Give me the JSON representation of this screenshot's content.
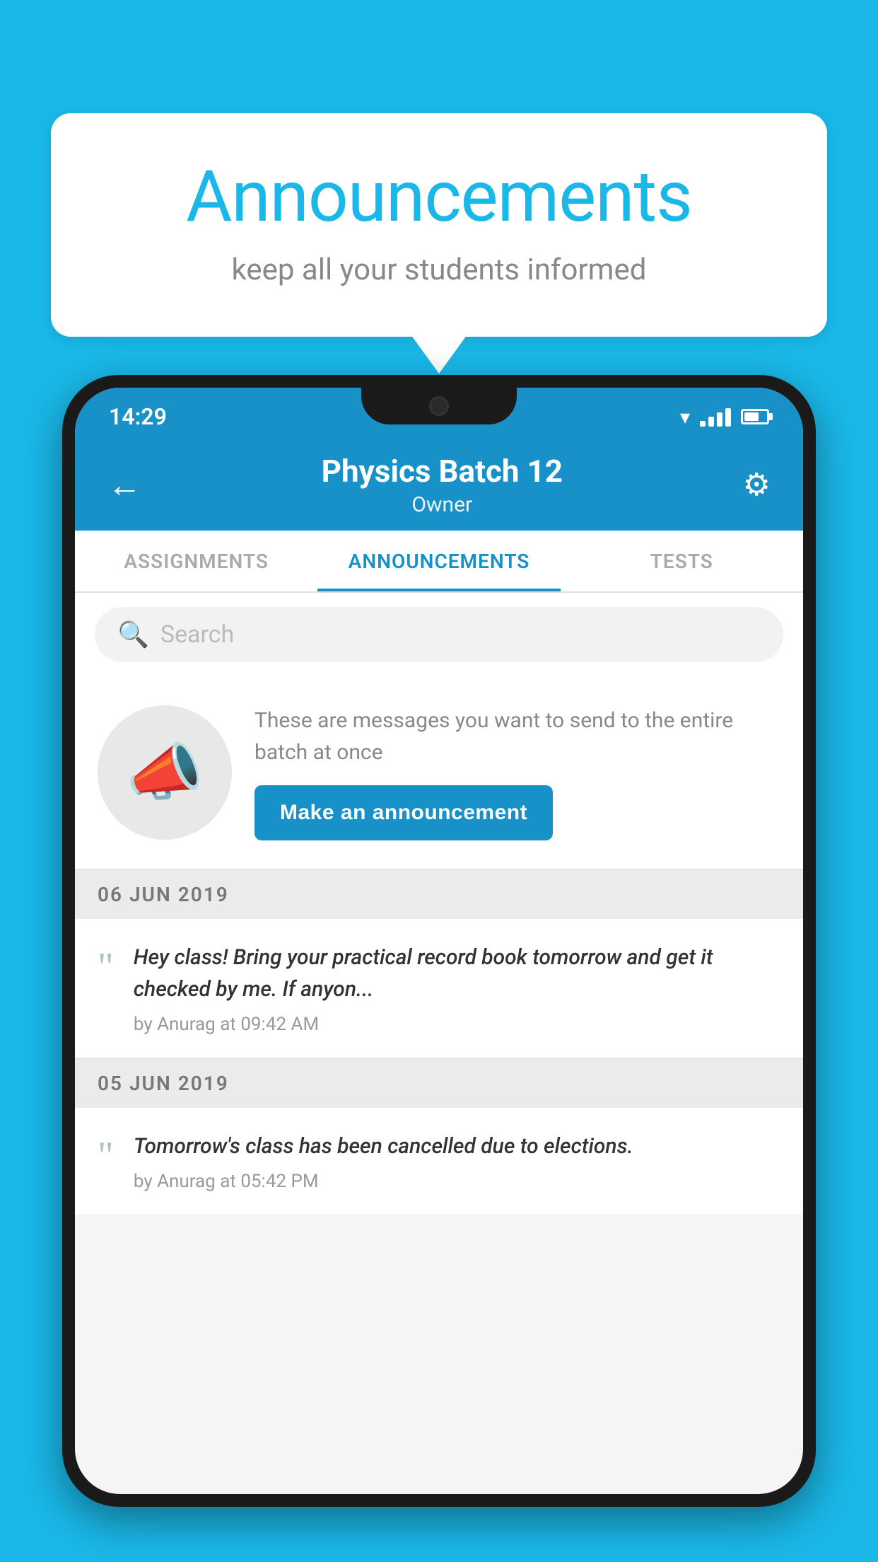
{
  "background_color": "#1ab8e8",
  "speech_bubble": {
    "title": "Announcements",
    "subtitle": "keep all your students informed"
  },
  "phone": {
    "status_bar": {
      "time": "14:29"
    },
    "header": {
      "back_label": "←",
      "title": "Physics Batch 12",
      "subtitle": "Owner",
      "gear_label": "⚙"
    },
    "tabs": [
      {
        "label": "ASSIGNMENTS",
        "active": false
      },
      {
        "label": "ANNOUNCEMENTS",
        "active": true
      },
      {
        "label": "TESTS",
        "active": false
      }
    ],
    "search": {
      "placeholder": "Search"
    },
    "promo": {
      "description": "These are messages you want to send to the entire batch at once",
      "button_label": "Make an announcement"
    },
    "announcement_groups": [
      {
        "date": "06  JUN  2019",
        "items": [
          {
            "text": "Hey class! Bring your practical record book tomorrow and get it checked by me. If anyon...",
            "meta": "by Anurag at 09:42 AM"
          }
        ]
      },
      {
        "date": "05  JUN  2019",
        "items": [
          {
            "text": "Tomorrow's class has been cancelled due to elections.",
            "meta": "by Anurag at 05:42 PM"
          }
        ]
      }
    ]
  }
}
